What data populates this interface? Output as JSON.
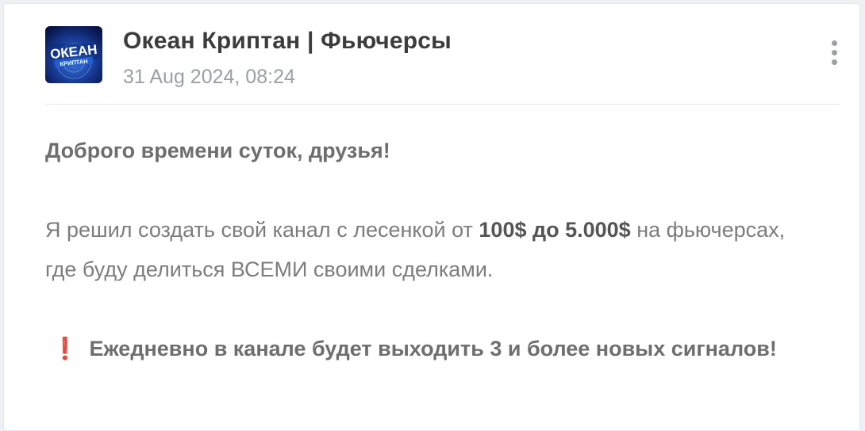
{
  "post": {
    "channel_name": "Океан Криптан | Фьючерсы",
    "date": "31 Aug 2024, 08:24",
    "avatar": {
      "icon": "channel-logo",
      "logo_text_top": "ОКЕАН",
      "logo_text_bottom": "КРИПТАН"
    },
    "menu_icon": "more-vertical-icon",
    "greeting": "Доброго времени суток, друзья!",
    "paragraph": {
      "part1": "Я решил создать свой канал с лесенкой от ",
      "bold": "100$ до 5.000$",
      "part2": " на фьючерсах, где буду делиться ВСЕМИ своими сделками."
    },
    "notice": {
      "emoji": "❗",
      "text": "Ежедневно в канале будет выходить 3 и более новых сигналов!"
    }
  },
  "colors": {
    "accent_red": "#e0263a",
    "text_dark": "#3c3c3c",
    "text_muted": "#9aa0a6"
  }
}
